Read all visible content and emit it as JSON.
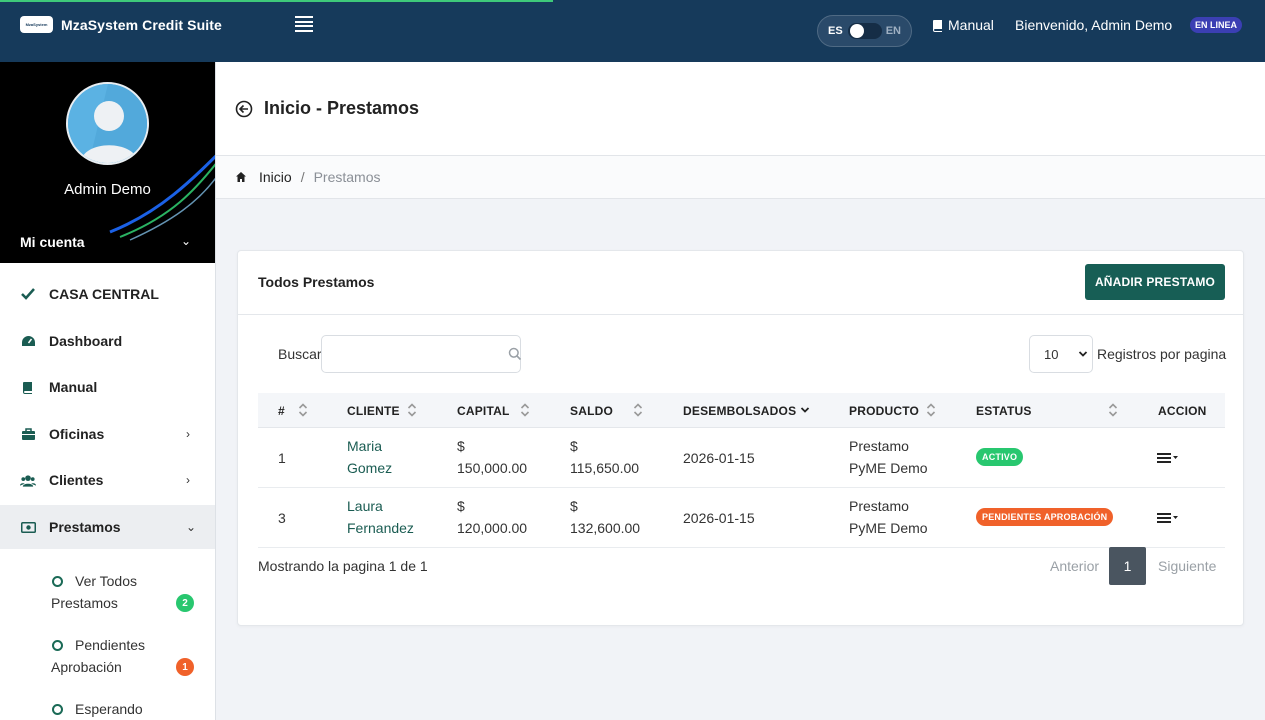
{
  "header": {
    "app_name": "MzaSystem Credit Suite",
    "logo_text": "MzaSystem",
    "lang_es": "ES",
    "lang_en": "EN",
    "manual_label": "Manual",
    "welcome": "Bienvenido, Admin Demo",
    "status_badge": "EN LINEA"
  },
  "sidebar": {
    "user_name": "Admin Demo",
    "account_label": "Mi cuenta",
    "items": [
      {
        "label": "CASA CENTRAL",
        "icon": "check-icon"
      },
      {
        "label": "Dashboard",
        "icon": "dashboard-icon"
      },
      {
        "label": "Manual",
        "icon": "book-icon"
      },
      {
        "label": "Oficinas",
        "icon": "briefcase-icon"
      },
      {
        "label": "Clientes",
        "icon": "users-icon"
      },
      {
        "label": "Prestamos",
        "icon": "money-icon"
      }
    ],
    "sub_items": [
      {
        "line1": "Ver Todos",
        "line2": "Prestamos",
        "count": "2",
        "color": "#28c76f"
      },
      {
        "line1": "Pendientes",
        "line2": "Aprobación",
        "count": "1",
        "color": "#f0612a"
      },
      {
        "line1": "Esperando",
        "line2": "",
        "count": "",
        "color": ""
      }
    ]
  },
  "page": {
    "title": "Inicio - Prestamos",
    "breadcrumb_home": "Inicio",
    "breadcrumb_sep": "/",
    "breadcrumb_current": "Prestamos"
  },
  "card": {
    "title": "Todos Prestamos",
    "add_button": "AÑADIR PRESTAMO",
    "search_label": "Buscar",
    "search_value": "",
    "page_size": "10",
    "page_size_label": "Registros por pagina",
    "columns": [
      "#",
      "CLIENTE",
      "CAPITAL",
      "SALDO",
      "DESEMBOLSADOS",
      "PRODUCTO",
      "ESTATUS",
      "ACCION"
    ],
    "rows": [
      {
        "id": "1",
        "client1": "Maria",
        "client2": "Gomez",
        "cap1": "$",
        "cap2": "150,000.00",
        "sal1": "$",
        "sal2": "115,650.00",
        "date": "2026-01-15",
        "prod1": "Prestamo",
        "prod2": "PyME Demo",
        "status": "ACTIVO",
        "status_color": "#28c76f"
      },
      {
        "id": "3",
        "client1": "Laura",
        "client2": "Fernandez",
        "cap1": "$",
        "cap2": "120,000.00",
        "sal1": "$",
        "sal2": "132,600.00",
        "date": "2026-01-15",
        "prod1": "Prestamo",
        "prod2": "PyME Demo",
        "status": "PENDIENTES APROBACIÓN",
        "status_color": "#f0612a"
      }
    ],
    "showing": "Mostrando la pagina 1 de 1",
    "prev": "Anterior",
    "current_page": "1",
    "next": "Siguiente"
  },
  "colors": {
    "topbar": "#163a5b",
    "primary": "#175e55",
    "accent_progress": "#3ec97a"
  }
}
